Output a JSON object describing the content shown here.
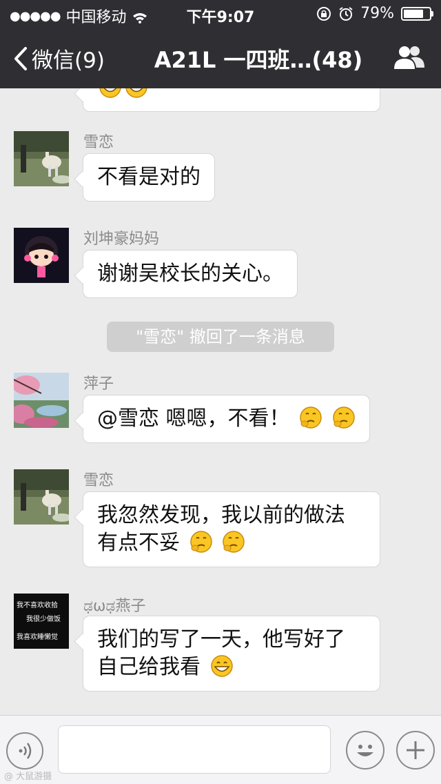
{
  "status_bar": {
    "signal": "●●●●●",
    "carrier": "中国移动",
    "time": "下午9:07",
    "battery_text": "79%",
    "battery_level": 0.79
  },
  "nav": {
    "back_label": "微信(9)",
    "title": "A21L 一四班…(48)"
  },
  "messages": [
    {
      "sender": "雪恋",
      "text": "不看是对的"
    },
    {
      "sender": "刘坤豪妈妈",
      "text": "谢谢吴校长的关心。"
    },
    {
      "sender": "萍子",
      "text": "@雪恋 嗯嗯，不看！"
    },
    {
      "sender": "雪恋",
      "line1": "我忽然发现，我以前的做法",
      "line2": "有点不妥"
    },
    {
      "sender": "ಢωಢ燕子",
      "line1": "我们的写了一天，他写好了",
      "line2": "自己给我看"
    }
  ],
  "system_notice": "\"雪恋\" 撤回了一条消息",
  "avatar_text": [
    "我不喜欢收拾",
    "我很少做饭",
    "我喜欢睡懒觉"
  ],
  "colors": {
    "nav_bg": "#2e2e33",
    "chat_bg": "#ebebeb",
    "bubble_bg": "#ffffff",
    "system_notice_bg": "#cfcfcf"
  },
  "watermark": "@ 大鼠游摄"
}
